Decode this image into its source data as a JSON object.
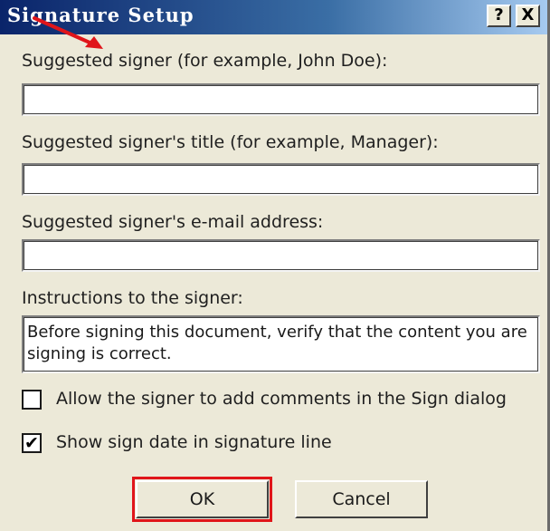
{
  "window": {
    "title": "Signature Setup",
    "help_label": "?",
    "close_label": "X"
  },
  "fields": {
    "signer_label": "Suggested signer (for example, John Doe):",
    "signer_value": "",
    "title_label": "Suggested signer's title (for example, Manager):",
    "title_value": "",
    "email_label": "Suggested signer's e-mail address:",
    "email_value": "",
    "instructions_label": "Instructions to the signer:",
    "instructions_value": "Before signing this document, verify that the content you are signing is correct."
  },
  "options": {
    "allow_comments_label": "Allow the signer to add comments in the Sign dialog",
    "allow_comments_checked": false,
    "show_date_label": "Show sign date in signature line",
    "show_date_checked": true
  },
  "buttons": {
    "ok_label": "OK",
    "cancel_label": "Cancel"
  },
  "annotation_colors": {
    "highlight": "#e0151a",
    "arrow": "#e0151a"
  }
}
